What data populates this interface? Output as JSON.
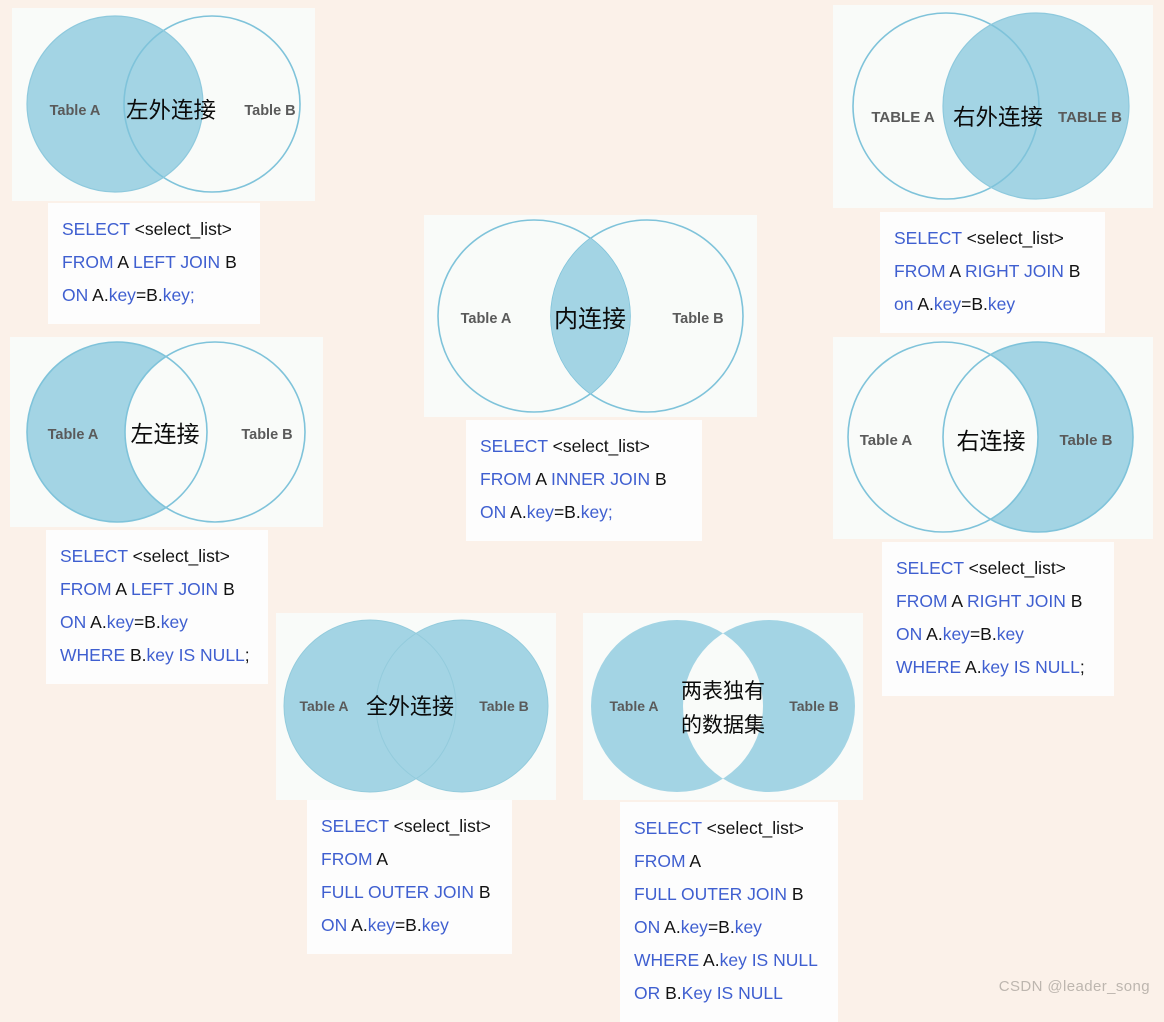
{
  "theme": {
    "background": "#fbf1e9",
    "panel_background": "#f9fbf9",
    "code_background": "#fdfdfd",
    "fill_color": "#a3d4e4",
    "stroke_color": "#7fc3da",
    "keyword_color": "#3f5fd0",
    "identifier_color": "#121212",
    "table_label_color": "#5a5a5a",
    "cn_label_color": "#0b0b0b",
    "watermark_color": "#bdb6af"
  },
  "watermark": "CSDN @leader_song",
  "panels": [
    {
      "id": "left-outer-join",
      "venn": {
        "label_a": "Table A",
        "label_b": "Table B",
        "label_center": "左外连接",
        "mode": "left-all"
      },
      "code": [
        [
          {
            "t": "SELECT ",
            "c": "kw"
          },
          {
            "t": "<select_list>",
            "c": "id"
          }
        ],
        [
          {
            "t": "FROM ",
            "c": "kw"
          },
          {
            "t": "A ",
            "c": "id"
          },
          {
            "t": "LEFT JOIN ",
            "c": "kw"
          },
          {
            "t": "B",
            "c": "id"
          }
        ],
        [
          {
            "t": "ON ",
            "c": "kw"
          },
          {
            "t": "A.",
            "c": "id"
          },
          {
            "t": "key",
            "c": "kw"
          },
          {
            "t": "=B.",
            "c": "id"
          },
          {
            "t": "key;",
            "c": "kw"
          }
        ]
      ]
    },
    {
      "id": "right-outer-join",
      "venn": {
        "label_a": "TABLE A",
        "label_b": "TABLE B",
        "label_center": "右外连接",
        "mode": "right-all"
      },
      "code": [
        [
          {
            "t": "SELECT ",
            "c": "kw"
          },
          {
            "t": "<select_list>",
            "c": "id"
          }
        ],
        [
          {
            "t": "FROM ",
            "c": "kw"
          },
          {
            "t": "A ",
            "c": "id"
          },
          {
            "t": "RIGHT JOIN ",
            "c": "kw"
          },
          {
            "t": "B",
            "c": "id"
          }
        ],
        [
          {
            "t": "on ",
            "c": "kw"
          },
          {
            "t": "A.",
            "c": "id"
          },
          {
            "t": "key",
            "c": "kw"
          },
          {
            "t": "=B.",
            "c": "id"
          },
          {
            "t": "key",
            "c": "kw"
          }
        ]
      ]
    },
    {
      "id": "inner-join",
      "venn": {
        "label_a": "Table A",
        "label_b": "Table B",
        "label_center": "内连接",
        "mode": "intersection"
      },
      "code": [
        [
          {
            "t": "SELECT ",
            "c": "kw"
          },
          {
            "t": "<select_list>",
            "c": "id"
          }
        ],
        [
          {
            "t": "FROM ",
            "c": "kw"
          },
          {
            "t": "A ",
            "c": "id"
          },
          {
            "t": "INNER JOIN ",
            "c": "kw"
          },
          {
            "t": "B",
            "c": "id"
          }
        ],
        [
          {
            "t": "ON ",
            "c": "kw"
          },
          {
            "t": "A.",
            "c": "id"
          },
          {
            "t": "key",
            "c": "kw"
          },
          {
            "t": "=B.",
            "c": "id"
          },
          {
            "t": "key;",
            "c": "kw"
          }
        ]
      ]
    },
    {
      "id": "left-join-excluding",
      "venn": {
        "label_a": "Table A",
        "label_b": "Table B",
        "label_center": "左连接",
        "mode": "left-only"
      },
      "code": [
        [
          {
            "t": "SELECT ",
            "c": "kw"
          },
          {
            "t": "<select_list>",
            "c": "id"
          }
        ],
        [
          {
            "t": "FROM ",
            "c": "kw"
          },
          {
            "t": "A ",
            "c": "id"
          },
          {
            "t": "LEFT JOIN ",
            "c": "kw"
          },
          {
            "t": "B",
            "c": "id"
          }
        ],
        [
          {
            "t": "ON ",
            "c": "kw"
          },
          {
            "t": "A.",
            "c": "id"
          },
          {
            "t": "key",
            "c": "kw"
          },
          {
            "t": "=B.",
            "c": "id"
          },
          {
            "t": "key",
            "c": "kw"
          }
        ],
        [
          {
            "t": "WHERE ",
            "c": "kw"
          },
          {
            "t": "B.",
            "c": "id"
          },
          {
            "t": "key IS NULL",
            "c": "kw"
          },
          {
            "t": ";",
            "c": "id"
          }
        ]
      ]
    },
    {
      "id": "right-join-excluding",
      "venn": {
        "label_a": "Table A",
        "label_b": "Table B",
        "label_center": "右连接",
        "mode": "right-only"
      },
      "code": [
        [
          {
            "t": "SELECT ",
            "c": "kw"
          },
          {
            "t": "<select_list>",
            "c": "id"
          }
        ],
        [
          {
            "t": "FROM ",
            "c": "kw"
          },
          {
            "t": "A ",
            "c": "id"
          },
          {
            "t": "RIGHT JOIN ",
            "c": "kw"
          },
          {
            "t": "B",
            "c": "id"
          }
        ],
        [
          {
            "t": "ON ",
            "c": "kw"
          },
          {
            "t": "A.",
            "c": "id"
          },
          {
            "t": "key",
            "c": "kw"
          },
          {
            "t": "=B.",
            "c": "id"
          },
          {
            "t": "key",
            "c": "kw"
          }
        ],
        [
          {
            "t": "WHERE ",
            "c": "kw"
          },
          {
            "t": "A.",
            "c": "id"
          },
          {
            "t": "key IS NULL",
            "c": "kw"
          },
          {
            "t": ";",
            "c": "id"
          }
        ]
      ]
    },
    {
      "id": "full-outer-join",
      "venn": {
        "label_a": "Table A",
        "label_b": "Table B",
        "label_center": "全外连接",
        "mode": "union"
      },
      "code": [
        [
          {
            "t": "SELECT ",
            "c": "kw"
          },
          {
            "t": "<select_list>",
            "c": "id"
          }
        ],
        [
          {
            "t": "FROM ",
            "c": "kw"
          },
          {
            "t": "A",
            "c": "id"
          }
        ],
        [
          {
            "t": "FULL OUTER JOIN ",
            "c": "kw"
          },
          {
            "t": "B",
            "c": "id"
          }
        ],
        [
          {
            "t": "ON ",
            "c": "kw"
          },
          {
            "t": "A.",
            "c": "id"
          },
          {
            "t": "key",
            "c": "kw"
          },
          {
            "t": "=B.",
            "c": "id"
          },
          {
            "t": "key",
            "c": "kw"
          }
        ]
      ]
    },
    {
      "id": "full-outer-join-excluding",
      "venn": {
        "label_a": "Table A",
        "label_b": "Table B",
        "label_center_line1": "两表独有",
        "label_center_line2": "的数据集",
        "mode": "symmetric-difference"
      },
      "code": [
        [
          {
            "t": "SELECT ",
            "c": "kw"
          },
          {
            "t": "<select_list>",
            "c": "id"
          }
        ],
        [
          {
            "t": "FROM ",
            "c": "kw"
          },
          {
            "t": "A",
            "c": "id"
          }
        ],
        [
          {
            "t": "FULL OUTER JOIN ",
            "c": "kw"
          },
          {
            "t": "B",
            "c": "id"
          }
        ],
        [
          {
            "t": "ON ",
            "c": "kw"
          },
          {
            "t": "A.",
            "c": "id"
          },
          {
            "t": "key",
            "c": "kw"
          },
          {
            "t": "=B.",
            "c": "id"
          },
          {
            "t": "key",
            "c": "kw"
          }
        ],
        [
          {
            "t": "WHERE ",
            "c": "kw"
          },
          {
            "t": "A.",
            "c": "id"
          },
          {
            "t": "key IS NULL",
            "c": "kw"
          }
        ],
        [
          {
            "t": "OR ",
            "c": "kw"
          },
          {
            "t": "B.",
            "c": "id"
          },
          {
            "t": "Key IS NULL",
            "c": "kw"
          }
        ]
      ]
    }
  ]
}
